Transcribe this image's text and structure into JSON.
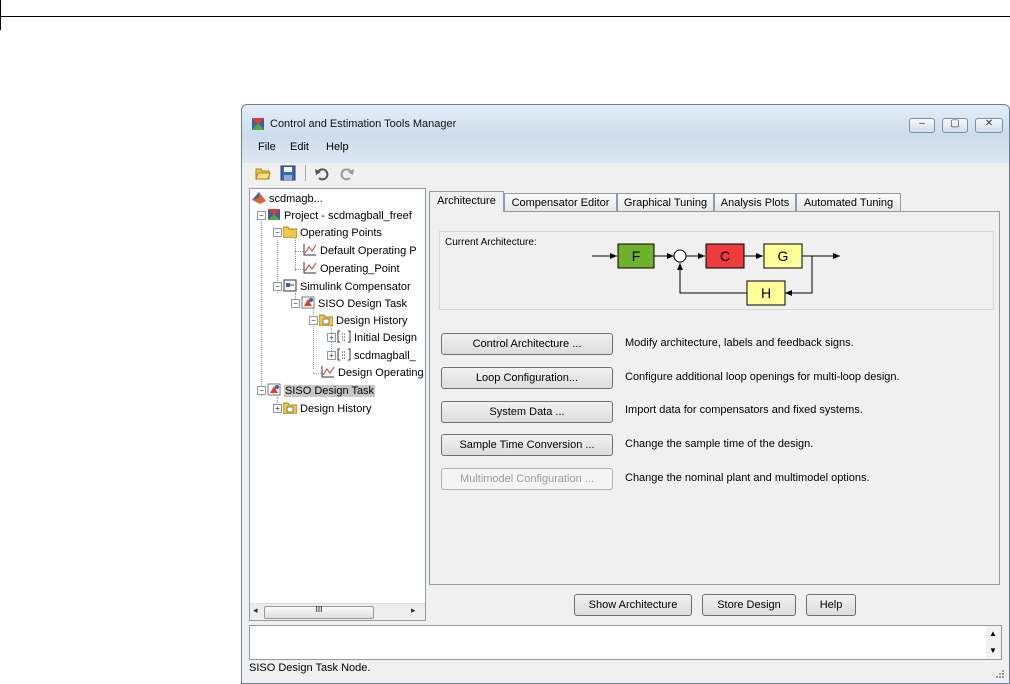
{
  "window": {
    "title": "Control and Estimation Tools Manager",
    "controls": {
      "minimize": "‒",
      "maximize": "▢",
      "close": "✕"
    }
  },
  "menu": [
    "File",
    "Edit",
    "Help"
  ],
  "toolbar": {
    "icons": [
      "open-folder-icon",
      "save-icon",
      "undo-icon",
      "redo-icon"
    ]
  },
  "tree": {
    "nodes": [
      {
        "label": "scdmagb...",
        "icon": "matlab-logo-icon"
      },
      {
        "label": "Project - scdmagball_freef",
        "icon": "project-icon",
        "toggle": "−"
      },
      {
        "label": "Operating Points",
        "icon": "folder-icon",
        "toggle": "−"
      },
      {
        "label": "Default Operating P",
        "icon": "operating-point-icon"
      },
      {
        "label": "Operating_Point",
        "icon": "operating-point-icon"
      },
      {
        "label": "Simulink Compensator",
        "icon": "simulink-icon",
        "toggle": "−"
      },
      {
        "label": "SISO Design Task",
        "icon": "siso-task-icon",
        "toggle": "−"
      },
      {
        "label": "Design History",
        "icon": "history-folder-icon",
        "toggle": "−"
      },
      {
        "label": "Initial Design",
        "icon": "design-icon",
        "toggle": "+"
      },
      {
        "label": "scdmagball_",
        "icon": "design-icon",
        "toggle": "+"
      },
      {
        "label": "Design Operating",
        "icon": "operating-point-icon"
      },
      {
        "label": "SISO Design Task",
        "icon": "siso-task-icon",
        "toggle": "−",
        "selected": true
      },
      {
        "label": "Design History",
        "icon": "history-folder-icon",
        "toggle": "+"
      }
    ],
    "scroll_thumb_glyph": "III",
    "scroll_left": "◂",
    "scroll_right": "▸"
  },
  "tabs": [
    {
      "label": "Architecture",
      "active": true
    },
    {
      "label": "Compensator Editor"
    },
    {
      "label": "Graphical Tuning"
    },
    {
      "label": "Analysis Plots"
    },
    {
      "label": "Automated Tuning"
    }
  ],
  "architecture": {
    "caption": "Current Architecture:",
    "blocks": {
      "F": {
        "label": "F",
        "color": "#70b12b"
      },
      "C": {
        "label": "C",
        "color": "#ec3c3c"
      },
      "G": {
        "label": "G",
        "color": "#ffff99"
      },
      "H": {
        "label": "H",
        "color": "#ffff99"
      }
    }
  },
  "actions": [
    {
      "button": "Control Architecture ...",
      "description": "Modify architecture, labels and feedback signs.",
      "enabled": true
    },
    {
      "button": "Loop Configuration...",
      "description": "Configure additional loop openings for multi-loop design.",
      "enabled": true
    },
    {
      "button": "System Data ...",
      "description": "Import data for compensators and fixed systems.",
      "enabled": true
    },
    {
      "button": "Sample Time Conversion ...",
      "description": "Change the sample time of the design.",
      "enabled": true
    },
    {
      "button": "Multimodel Configuration ...",
      "description": "Change the nominal plant and multimodel options.",
      "enabled": false
    }
  ],
  "bottom_buttons": {
    "show": "Show Architecture",
    "store": "Store Design",
    "help": "Help"
  },
  "status": "SISO Design Task Node.",
  "message_scroll": {
    "up": "▲",
    "down": "▼"
  }
}
